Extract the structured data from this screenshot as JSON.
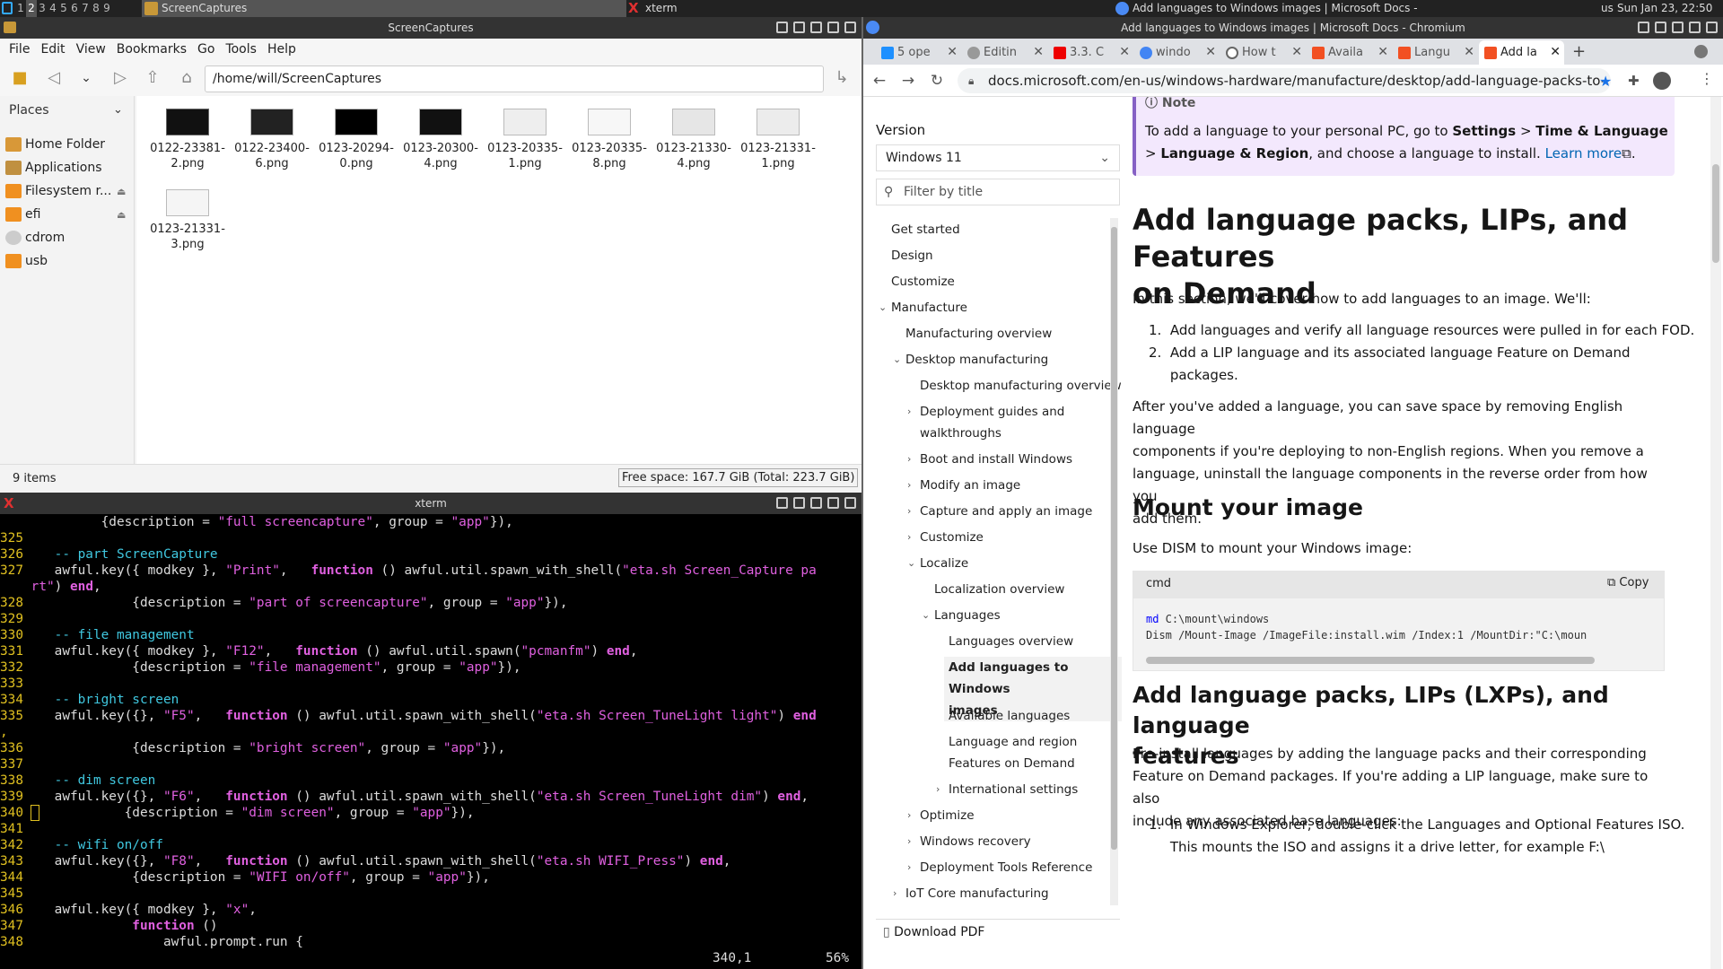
{
  "taskbar": {
    "workspaces": [
      "1",
      "2",
      "3",
      "4",
      "5",
      "6",
      "7",
      "8",
      "9"
    ],
    "active_workspace": "2",
    "tasks": [
      "ScreenCaptures",
      "xterm",
      "Add languages to Windows images | Microsoft Docs - Chromium"
    ],
    "locale": "us",
    "clock": "Sun Jan 23, 22:50"
  },
  "filemanager": {
    "title": "ScreenCaptures",
    "menu": [
      "File",
      "Edit",
      "View",
      "Bookmarks",
      "Go",
      "Tools",
      "Help"
    ],
    "path": "/home/will/ScreenCaptures",
    "places_header": "Places",
    "places": [
      "Home Folder",
      "Applications",
      "Filesystem r...",
      "efi",
      "cdrom",
      "usb"
    ],
    "files": [
      {
        "l1": "0122-23381-",
        "l2": "2.png"
      },
      {
        "l1": "0122-23400-",
        "l2": "6.png"
      },
      {
        "l1": "0123-20294-",
        "l2": "0.png"
      },
      {
        "l1": "0123-20300-",
        "l2": "4.png"
      },
      {
        "l1": "0123-20335-",
        "l2": "1.png"
      },
      {
        "l1": "0123-20335-",
        "l2": "8.png"
      },
      {
        "l1": "0123-21330-",
        "l2": "4.png"
      },
      {
        "l1": "0123-21331-",
        "l2": "1.png"
      },
      {
        "l1": "0123-21331-",
        "l2": "3.png"
      }
    ],
    "item_count": "9 items",
    "free_space": "Free space: 167.7 GiB (Total: 223.7 GiB)"
  },
  "xterm": {
    "title": "xterm",
    "position": "340,1",
    "percent": "56%"
  },
  "chromium": {
    "title": "Add languages to Windows images | Microsoft Docs - Chromium",
    "tabs": [
      "5 ope",
      "Editin",
      "3.3. C",
      "windo",
      "How t",
      "Availa",
      "Langu",
      "Add la"
    ],
    "url": "docs.microsoft.com/en-us/windows-hardware/manufacture/desktop/add-language-packs-to-..."
  },
  "docs": {
    "version_label": "Version",
    "version_value": "Windows 11",
    "filter_placeholder": "Filter by title",
    "toc": {
      "get_started": "Get started",
      "design": "Design",
      "customize": "Customize",
      "manufacture": "Manufacture",
      "manufacturing_overview": "Manufacturing overview",
      "desktop_manufacturing": "Desktop manufacturing",
      "desktop_manufacturing_overview": "Desktop manufacturing overview",
      "deployment_guides_1": "Deployment guides and",
      "deployment_guides_2": "walkthroughs",
      "boot_install": "Boot and install Windows",
      "modify_image": "Modify an image",
      "capture_apply": "Capture and apply an image",
      "customize2": "Customize",
      "localize": "Localize",
      "localization_overview": "Localization overview",
      "languages": "Languages",
      "languages_overview": "Languages overview",
      "add_languages_1": "Add languages to Windows",
      "add_languages_2": "images",
      "available_languages": "Available languages",
      "language_region_1": "Language and region",
      "language_region_2": "Features on Demand",
      "international_settings": "International settings",
      "optimize": "Optimize",
      "windows_recovery": "Windows recovery",
      "deployment_tools": "Deployment Tools Reference",
      "iot_core": "IoT Core manufacturing"
    },
    "download_pdf": "Download PDF",
    "note_label": "Note",
    "note_text_1": "To add a language to your personal PC, go to",
    "note_settings": "Settings",
    "note_time": "Time & Language",
    "note_region": "Language & Region",
    "note_text_2": ", and choose a language to install.",
    "note_link": "Learn more",
    "h1_1": "Add language packs, LIPs, and Features",
    "h1_2": "on Demand",
    "intro": "In this section, we'll cover how to add languages to an image. We'll:",
    "li1": "Add languages and verify all language resources were pulled in for each FOD.",
    "li2_1": "Add a LIP language and its associated language Feature on Demand",
    "li2_2": "packages.",
    "para2_1": "After you've added a language, you can save space by removing English language",
    "para2_2": "components if you're deploying to non-English regions. When you remove a",
    "para2_3": "language, uninstall the language components in the reverse order from how you",
    "para2_4": "add them.",
    "h2_mount": "Mount your image",
    "mount_text": "Use DISM to mount your Windows image:",
    "code_lang": "cmd",
    "copy_label": "Copy",
    "code_kw": "md",
    "code_line1": " C:\\mount\\windows",
    "code_line2": "Dism /Mount-Image /ImageFile:install.wim /Index:1 /MountDir:\"C:\\moun",
    "h2_add_1": "Add language packs, LIPs (LXPs), and language",
    "h2_add_2": "features",
    "pre_1": "Pre-install languages by adding the language packs and their corresponding",
    "pre_2": "Feature on Demand packages. If you're adding a LIP language, make sure to also",
    "pre_3": "include any associated base languages:",
    "step1_1": "In Windows Explorer, double-click the Languages and Optional Features ISO.",
    "step1_2": "This mounts the ISO and assigns it a drive letter, for example F:\\"
  },
  "colors": {
    "accent_purple": "#8661c5",
    "link_blue": "#0065b3",
    "terminal_yellow": "#e0c020",
    "terminal_magenta": "#e060e0",
    "terminal_cyan": "#40c8e0"
  }
}
